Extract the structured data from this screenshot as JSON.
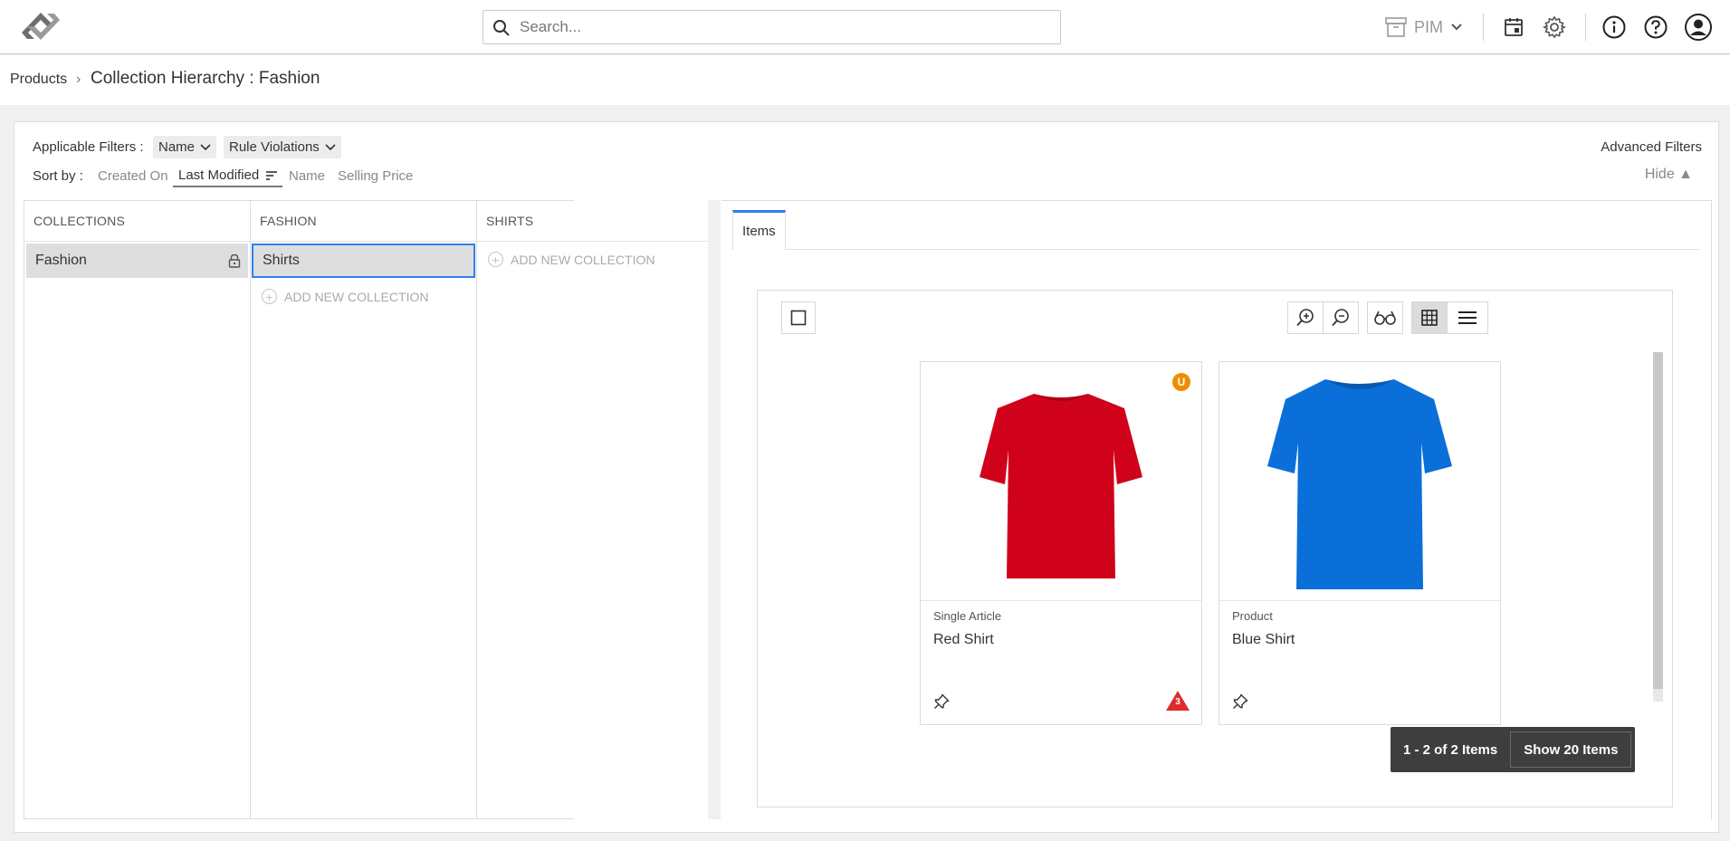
{
  "header": {
    "search_placeholder": "Search...",
    "module_label": "PIM",
    "icons": [
      "logo-icon",
      "search-icon",
      "archive-icon",
      "chevron-down-icon",
      "calendar-icon",
      "gear-icon",
      "info-icon",
      "help-icon",
      "user-icon"
    ]
  },
  "breadcrumb": {
    "root": "Products",
    "separator": "›",
    "current": "Collection Hierarchy : Fashion"
  },
  "filters": {
    "label": "Applicable Filters :",
    "chips": [
      "Name",
      "Rule Violations"
    ],
    "advanced": "Advanced Filters"
  },
  "sort": {
    "label": "Sort by :",
    "options": [
      "Created On",
      "Last Modified",
      "Name",
      "Selling Price"
    ],
    "active": "Last Modified",
    "hide": "Hide ▲"
  },
  "columns": [
    {
      "header": "COLLECTIONS",
      "items": [
        "Fashion"
      ],
      "add_new": ""
    },
    {
      "header": "FASHION",
      "items": [
        "Shirts"
      ],
      "add_new": "ADD NEW COLLECTION"
    },
    {
      "header": "SHIRTS",
      "items": [],
      "add_new": "ADD NEW COLLECTION"
    }
  ],
  "tabs": [
    "Items"
  ],
  "cards": [
    {
      "type": "Single Article",
      "name": "Red Shirt",
      "badge": "U",
      "warning_count": "3",
      "color": "#d0021b"
    },
    {
      "type": "Product",
      "name": "Blue Shirt",
      "badge": "",
      "warning_count": "",
      "color": "#0a6fd8"
    }
  ],
  "pager": {
    "range": "1 - 2 of 2 Items",
    "show": "Show 20 Items"
  },
  "colors": {
    "accent": "#2f80ed",
    "selected_bg": "#dedede",
    "badge_orange": "#f08c00",
    "warn_red": "#e02b2b"
  }
}
